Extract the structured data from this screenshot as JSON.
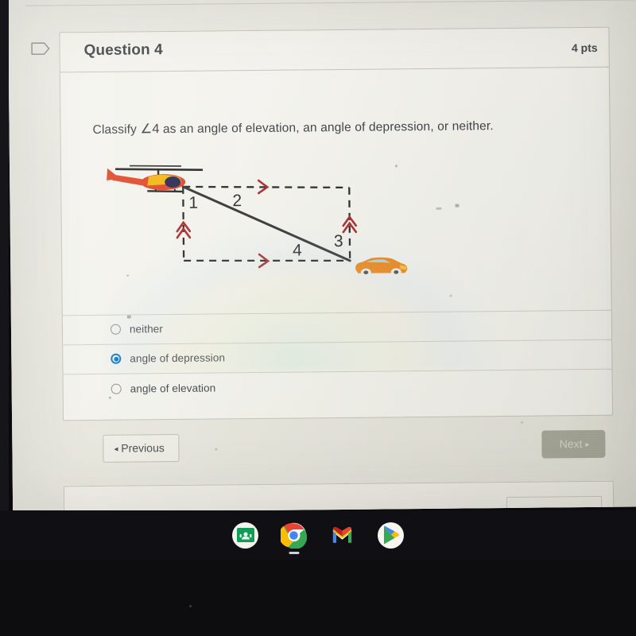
{
  "question_card": {
    "flag_icon": "flag-icon",
    "title": "Question 4",
    "points": "4 pts",
    "prompt_before": "Classify ",
    "prompt_angle": "∠4",
    "prompt_after": " as an angle of elevation, an angle of depression, or neither."
  },
  "diagram": {
    "name": "helicopter-car-angle-diagram",
    "helicopter_icon": "helicopter-icon",
    "car_icon": "car-icon",
    "labels": [
      "1",
      "2",
      "3",
      "4"
    ],
    "line_style": "dashed-rectangle-with-diagonal",
    "tick_color": "#b03535",
    "line_color": "#2b2b2b"
  },
  "answers": {
    "options": [
      {
        "label": "neither",
        "selected": false
      },
      {
        "label": "angle of depression",
        "selected": true
      },
      {
        "label": "angle of elevation",
        "selected": false
      }
    ],
    "selected_color": "#0a76c8"
  },
  "navigation": {
    "previous_caret": "◂",
    "previous_label": "Previous",
    "next_label": "Next",
    "next_caret": "▸",
    "next_disabled": true
  },
  "taskbar": {
    "icons": [
      {
        "name": "google-classroom-icon",
        "active": false
      },
      {
        "name": "google-chrome-icon",
        "active": true
      },
      {
        "name": "gmail-icon",
        "active": false
      },
      {
        "name": "google-play-store-icon",
        "active": false
      }
    ]
  }
}
